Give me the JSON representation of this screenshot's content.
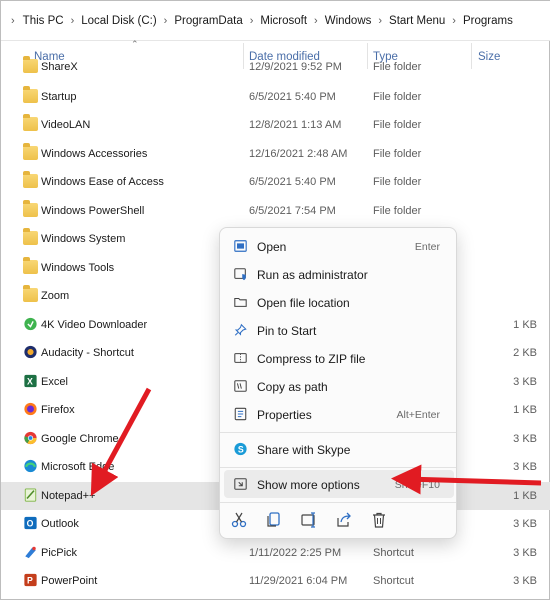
{
  "breadcrumb": {
    "items": [
      "This PC",
      "Local Disk (C:)",
      "ProgramData",
      "Microsoft",
      "Windows",
      "Start Menu",
      "Programs"
    ]
  },
  "columns": {
    "name": "Name",
    "date": "Date modified",
    "type": "Type",
    "size": "Size"
  },
  "rows": [
    {
      "name": "ShareX",
      "date": "12/9/2021 9:52 PM",
      "type": "File folder",
      "size": "",
      "icon": "folder-icon"
    },
    {
      "name": "Startup",
      "date": "6/5/2021 5:40 PM",
      "type": "File folder",
      "size": "",
      "icon": "folder-icon"
    },
    {
      "name": "VideoLAN",
      "date": "12/8/2021 1:13 AM",
      "type": "File folder",
      "size": "",
      "icon": "folder-icon"
    },
    {
      "name": "Windows Accessories",
      "date": "12/16/2021 2:48 AM",
      "type": "File folder",
      "size": "",
      "icon": "folder-icon"
    },
    {
      "name": "Windows Ease of Access",
      "date": "6/5/2021 5:40 PM",
      "type": "File folder",
      "size": "",
      "icon": "folder-icon"
    },
    {
      "name": "Windows PowerShell",
      "date": "6/5/2021 7:54 PM",
      "type": "File folder",
      "size": "",
      "icon": "folder-icon"
    },
    {
      "name": "Windows System",
      "date": "",
      "type": "",
      "size": "",
      "icon": "folder-icon"
    },
    {
      "name": "Windows Tools",
      "date": "",
      "type": "",
      "size": "",
      "icon": "folder-icon"
    },
    {
      "name": "Zoom",
      "date": "",
      "type": "",
      "size": "",
      "icon": "folder-icon"
    },
    {
      "name": "4K Video Downloader",
      "date": "",
      "type": "",
      "size": "1 KB",
      "icon": "4k-video-downloader-icon"
    },
    {
      "name": "Audacity - Shortcut",
      "date": "",
      "type": "",
      "size": "2 KB",
      "icon": "audacity-icon"
    },
    {
      "name": "Excel",
      "date": "",
      "type": "",
      "size": "3 KB",
      "icon": "excel-icon"
    },
    {
      "name": "Firefox",
      "date": "",
      "type": "",
      "size": "1 KB",
      "icon": "firefox-icon"
    },
    {
      "name": "Google Chrome",
      "date": "",
      "type": "",
      "size": "3 KB",
      "icon": "chrome-icon"
    },
    {
      "name": "Microsoft Edge",
      "date": "",
      "type": "",
      "size": "3 KB",
      "icon": "edge-icon"
    },
    {
      "name": "Notepad++",
      "date": "",
      "type": "",
      "size": "1 KB",
      "icon": "notepadpp-icon"
    },
    {
      "name": "Outlook",
      "date": "",
      "type": "",
      "size": "3 KB",
      "icon": "outlook-icon"
    },
    {
      "name": "PicPick",
      "date": "1/11/2022 2:25 PM",
      "type": "Shortcut",
      "size": "3 KB",
      "icon": "picpick-icon"
    },
    {
      "name": "PowerPoint",
      "date": "11/29/2021 6:04 PM",
      "type": "Shortcut",
      "size": "3 KB",
      "icon": "powerpoint-icon"
    }
  ],
  "context_menu": {
    "items": [
      {
        "label": "Open",
        "shortcut": "Enter",
        "icon": "open-icon"
      },
      {
        "label": "Run as administrator",
        "shortcut": "",
        "icon": "shield-icon"
      },
      {
        "label": "Open file location",
        "shortcut": "",
        "icon": "folder-open-icon"
      },
      {
        "label": "Pin to Start",
        "shortcut": "",
        "icon": "pin-icon"
      },
      {
        "label": "Compress to ZIP file",
        "shortcut": "",
        "icon": "zip-icon"
      },
      {
        "label": "Copy as path",
        "shortcut": "",
        "icon": "copy-path-icon"
      },
      {
        "label": "Properties",
        "shortcut": "Alt+Enter",
        "icon": "properties-icon"
      },
      {
        "label": "Share with Skype",
        "shortcut": "",
        "icon": "skype-icon"
      },
      {
        "label": "Show more options",
        "shortcut": "Shift+F10",
        "icon": "show-more-icon"
      }
    ],
    "bottom_actions": [
      "cut-icon",
      "copy-icon",
      "rename-icon",
      "share-icon",
      "delete-icon"
    ]
  },
  "colors": {
    "accent": "#2f6fc4",
    "arrow": "#e11b22",
    "selection": "#e5e5e5",
    "header_text": "#4a6ea8"
  }
}
